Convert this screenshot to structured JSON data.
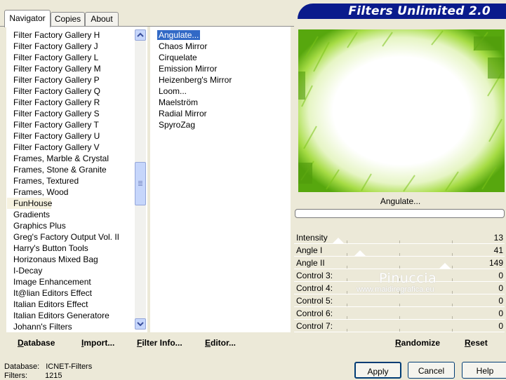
{
  "tabs": [
    "Navigator",
    "Copies",
    "About"
  ],
  "banner_title": "Filters Unlimited 2.0",
  "categories": [
    "Filter Factory Gallery H",
    "Filter Factory Gallery J",
    "Filter Factory Gallery L",
    "Filter Factory Gallery M",
    "Filter Factory Gallery P",
    "Filter Factory Gallery Q",
    "Filter Factory Gallery R",
    "Filter Factory Gallery S",
    "Filter Factory Gallery T",
    "Filter Factory Gallery U",
    "Filter Factory Gallery V",
    "Frames, Marble & Crystal",
    "Frames, Stone & Granite",
    "Frames, Textured",
    "Frames, Wood",
    "FunHouse",
    "Gradients",
    "Graphics Plus",
    "Greg's Factory Output Vol. II",
    "Harry's Button Tools",
    "Horizonaus Mixed Bag",
    "I-Decay",
    "Image Enhancement",
    "It@lian Editors Effect",
    "Italian Editors Effect",
    "Italian Editors Generatore",
    "Johann's Filters"
  ],
  "selected_category": "FunHouse",
  "filters": [
    "Angulate...",
    "Chaos Mirror",
    "Cirquelate",
    "Emission Mirror",
    "Heizenberg's Mirror",
    "Loom...",
    "Maelström",
    "Radial Mirror",
    "SpyroZag"
  ],
  "selected_filter": "Angulate...",
  "preview_caption": "Angulate...",
  "controls": [
    {
      "label": "Intensity",
      "value": "13"
    },
    {
      "label": "Angle I",
      "value": "41"
    },
    {
      "label": "Angle II",
      "value": "149"
    },
    {
      "label": "Control 3:",
      "value": "0"
    },
    {
      "label": "Control 4:",
      "value": "0"
    },
    {
      "label": "Control 5:",
      "value": "0"
    },
    {
      "label": "Control 6:",
      "value": "0"
    },
    {
      "label": "Control 7:",
      "value": "0"
    }
  ],
  "watermark": {
    "name": "Pinuccia",
    "url": "www.maidiregrafica.eu"
  },
  "left_buttons": {
    "database": "Database",
    "import": "Import...",
    "filter_info": "Filter Info...",
    "editor": "Editor..."
  },
  "right_buttons": {
    "randomize": "Randomize",
    "reset": "Reset"
  },
  "status": {
    "database_label": "Database:",
    "database_value": "ICNET-Filters",
    "filters_label": "Filters:",
    "filters_value": "1215"
  },
  "dialog_buttons": {
    "apply": "Apply",
    "cancel": "Cancel",
    "help": "Help"
  },
  "icons": {
    "scroll_up": "chevron-up-icon",
    "scroll_down": "chevron-down-icon"
  },
  "colors": {
    "banner": "#0a1b8c",
    "selection": "#3169c6",
    "preview_green": "#8fd11e"
  }
}
